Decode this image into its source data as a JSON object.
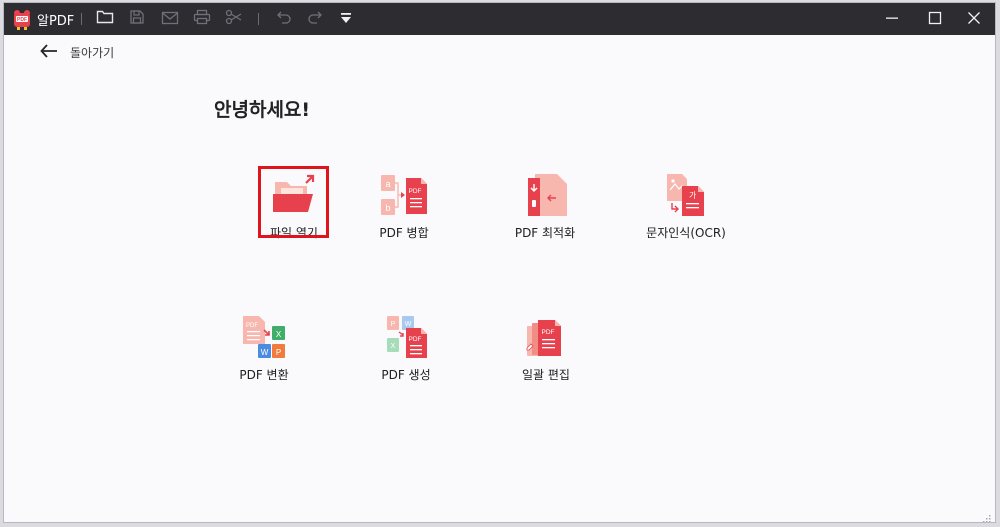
{
  "app": {
    "name": "알PDF"
  },
  "back": {
    "label": "돌아가기"
  },
  "greeting": "안녕하세요!",
  "tiles": [
    {
      "label": "파일 열기"
    },
    {
      "label": "PDF 병합"
    },
    {
      "label": "PDF 최적화"
    },
    {
      "label": "문자인식(OCR)"
    },
    {
      "label": "PDF 변환"
    },
    {
      "label": "PDF 생성"
    },
    {
      "label": "일괄 편집"
    }
  ],
  "icon_text": {
    "pdf": "PDF",
    "ga": "가",
    "a": "a",
    "b": "b",
    "x": "X",
    "w": "W",
    "p": "P"
  },
  "colors": {
    "titlebar": "#2c2c31",
    "accent_red": "#e8414e",
    "light_red": "#f7b7ae",
    "selection": "#e0141d"
  }
}
